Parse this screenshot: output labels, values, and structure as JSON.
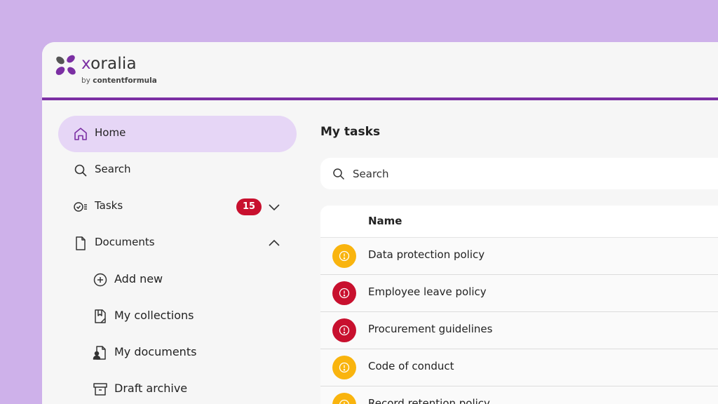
{
  "brand": {
    "name_prefix": "x",
    "name_rest": "oralia",
    "by_prefix": "by ",
    "by_company": "contentformula"
  },
  "colors": {
    "background": "#ceb1ea",
    "accent": "#7b2fa3",
    "active_nav": "#e6d6f6",
    "badge": "#c8102e",
    "warning": "#f9b40e",
    "alert": "#c8102e"
  },
  "sidebar": {
    "items": [
      {
        "label": "Home",
        "icon": "home-icon",
        "active": true
      },
      {
        "label": "Search",
        "icon": "search-icon"
      },
      {
        "label": "Tasks",
        "icon": "tasks-icon",
        "badge": "15",
        "expand_icon": "chevron-down-icon"
      },
      {
        "label": "Documents",
        "icon": "document-icon",
        "expand_icon": "chevron-up-icon"
      },
      {
        "label": "Add new",
        "icon": "plus-circle-icon"
      },
      {
        "label": "My collections",
        "icon": "collection-icon"
      },
      {
        "label": "My documents",
        "icon": "user-document-icon"
      },
      {
        "label": "Draft archive",
        "icon": "archive-icon"
      }
    ]
  },
  "main": {
    "title": "My tasks",
    "search_placeholder": "Search",
    "table": {
      "column_name": "Name",
      "rows": [
        {
          "name": "Data protection policy",
          "status": "warning"
        },
        {
          "name": "Employee leave policy",
          "status": "alert"
        },
        {
          "name": "Procurement guidelines",
          "status": "alert"
        },
        {
          "name": "Code of conduct",
          "status": "warning"
        },
        {
          "name": "Record retention policy",
          "status": "warning"
        }
      ]
    }
  }
}
